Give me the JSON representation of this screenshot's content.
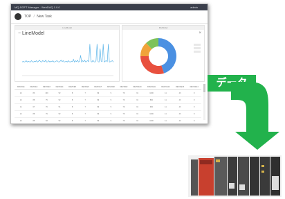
{
  "window": {
    "title": "MQ-SOFT Manager - WebDAQ 1.0.0",
    "user": "admin"
  },
  "breadcrumb": {
    "root": "TOP",
    "separator": "/",
    "current": "New Task"
  },
  "line_panel": {
    "header": "LineModel",
    "title": "LineModel",
    "collapse": "−"
  },
  "pie_panel": {
    "header": "PieModel",
    "close": "×"
  },
  "table": {
    "columns": [
      "DEVICE1",
      "DEVICE2",
      "DEVICE3",
      "DEVICE4",
      "DEVICE5",
      "DEVICE6",
      "DEVICE7",
      "DEVICE8",
      "DEVICE9",
      "DEVICE10",
      "DEVICE11",
      "DEVICE12",
      "DEVICE13",
      "DEVICE14"
    ],
    "rows": [
      [
        "12",
        "83",
        "100",
        "52",
        "8",
        "7",
        "99",
        "9",
        "79",
        "31",
        "1000",
        "11",
        "43",
        "9"
      ],
      [
        "12",
        "88",
        "75",
        "52",
        "8",
        "7",
        "99",
        "9",
        "79",
        "31",
        "800",
        "11",
        "43",
        "9"
      ],
      [
        "11",
        "67",
        "76",
        "51",
        "8",
        "7",
        "99",
        "9",
        "79",
        "31",
        "900",
        "11",
        "43",
        "9"
      ],
      [
        "12",
        "88",
        "79",
        "52",
        "8",
        "7",
        "99",
        "9",
        "79",
        "31",
        "1000",
        "11",
        "43",
        "9"
      ],
      [
        "12",
        "85",
        "83",
        "52",
        "8",
        "7",
        "99",
        "9",
        "79",
        "31",
        "1000",
        "11",
        "43",
        "9"
      ],
      [
        "11",
        "83",
        "100",
        "52",
        "8",
        "7",
        "99",
        "9",
        "79",
        "31",
        "1000",
        "11",
        "43",
        "9"
      ],
      [
        "12",
        "87",
        "77",
        "52",
        "8",
        "7",
        "99",
        "9",
        "79",
        "31",
        "900",
        "11",
        "43",
        "9"
      ]
    ]
  },
  "flow_label": "データ",
  "colors": {
    "accent_green": "#22b24c",
    "line_series": "#5ab4e8",
    "pie_blue": "#4a90e2",
    "pie_red": "#e8503e",
    "pie_orange": "#f0a33a",
    "pie_green": "#7ec25a",
    "plc_red": "#c8402e"
  },
  "chart_data": [
    {
      "type": "line",
      "series": [
        {
          "values": [
            30,
            32,
            30,
            31,
            33,
            30,
            32,
            31,
            30,
            33,
            31,
            30,
            32,
            31,
            33,
            30,
            32,
            34,
            31,
            30,
            33,
            32,
            31,
            34,
            30,
            31,
            33,
            30,
            32,
            31,
            33,
            30,
            31,
            32,
            33,
            31,
            30,
            32,
            34,
            31,
            33,
            30,
            31,
            32,
            30,
            33,
            31,
            30,
            32,
            31,
            36,
            30,
            33,
            31,
            34,
            30,
            32,
            45,
            30,
            33,
            31,
            34,
            30,
            32,
            33,
            31,
            70,
            32,
            30,
            34,
            31,
            30,
            33,
            70,
            31,
            30,
            60,
            32,
            31,
            70,
            30,
            32,
            33,
            31,
            70,
            30,
            31,
            32,
            33,
            30
          ]
        }
      ],
      "ylim": [
        0,
        80
      ]
    },
    {
      "type": "pie",
      "slices": [
        {
          "value": 45
        },
        {
          "value": 30
        },
        {
          "value": 13
        },
        {
          "value": 12
        }
      ]
    }
  ]
}
